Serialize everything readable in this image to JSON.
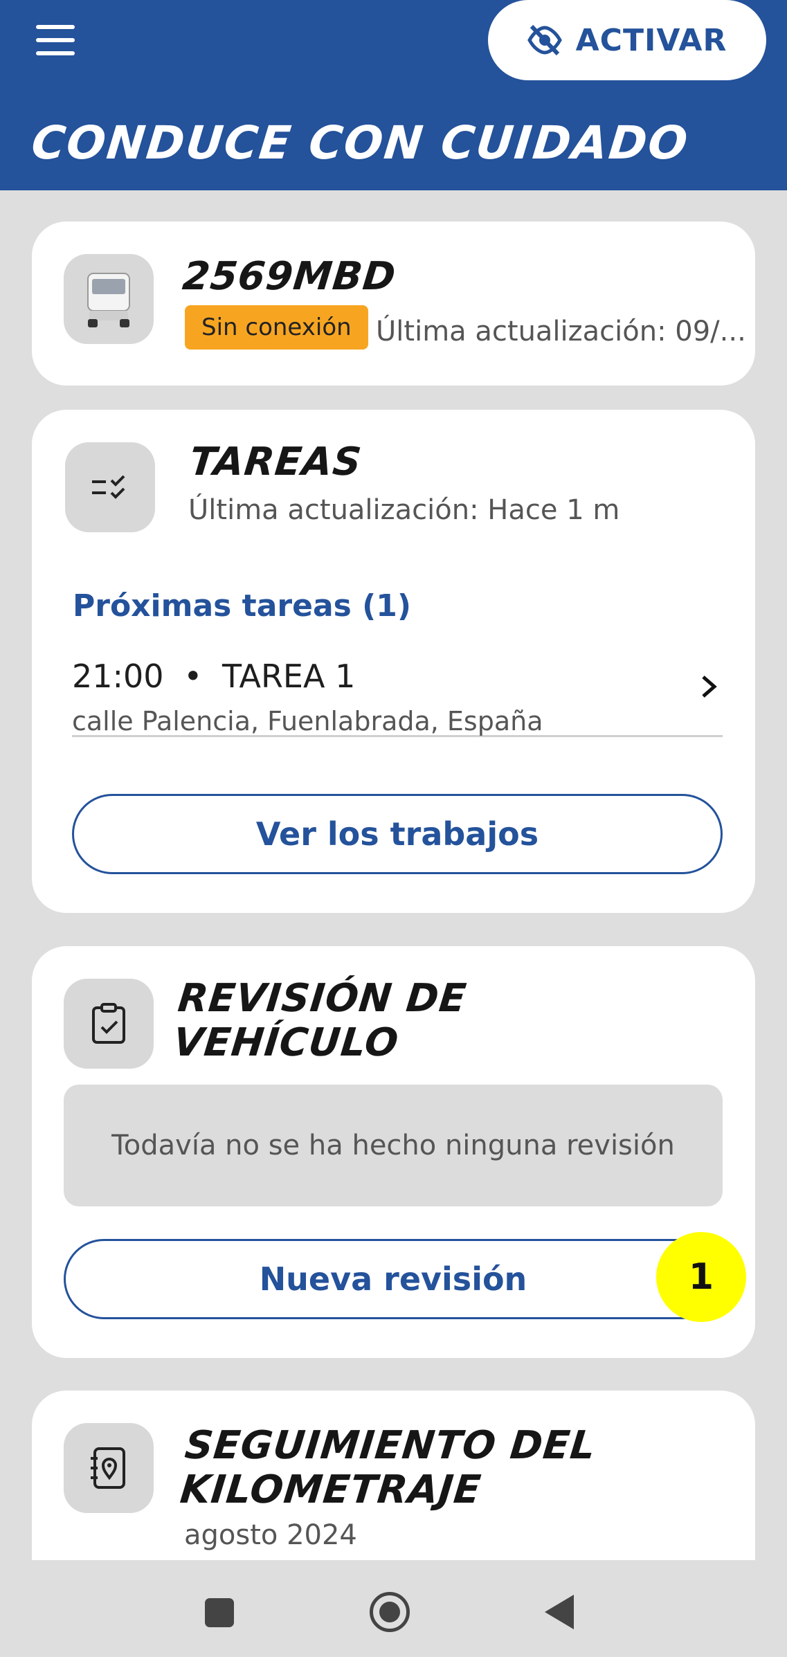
{
  "header": {
    "activate_label": "ACTIVAR",
    "title": "CONDUCE CON CUIDADO",
    "color": "#24529b"
  },
  "vehicle": {
    "plate": "2569MBD",
    "status_badge": "Sin conexión",
    "last_update": "Última actualización: 09/..."
  },
  "tasks": {
    "title": "TAREAS",
    "last_update": "Última actualización: Hace 1 m",
    "upcoming_heading": "Próximas tareas (1)",
    "items": [
      {
        "time": "21:00",
        "separator": "•",
        "name": "TAREA 1",
        "address": "calle Palencia, Fuenlabrada, España"
      }
    ],
    "view_jobs_label": "Ver los trabajos"
  },
  "inspection": {
    "title_line1": "REVISIÓN DE",
    "title_line2": "VEHÍCULO",
    "empty_text": "Todavía no se ha hecho ninguna revisión",
    "new_label": "Nueva revisión",
    "step_marker": "1"
  },
  "mileage": {
    "title_line1": "SEGUIMIENTO DEL",
    "title_line2": "KILOMETRAJE",
    "period": "agosto 2024"
  },
  "icons": [
    "menu-icon",
    "eye-off-icon",
    "truck-icon",
    "task-list-icon",
    "clipboard-check-icon",
    "map-pin-book-icon",
    "chevron-right-icon",
    "nav-recents-icon",
    "nav-home-icon",
    "nav-back-icon"
  ]
}
